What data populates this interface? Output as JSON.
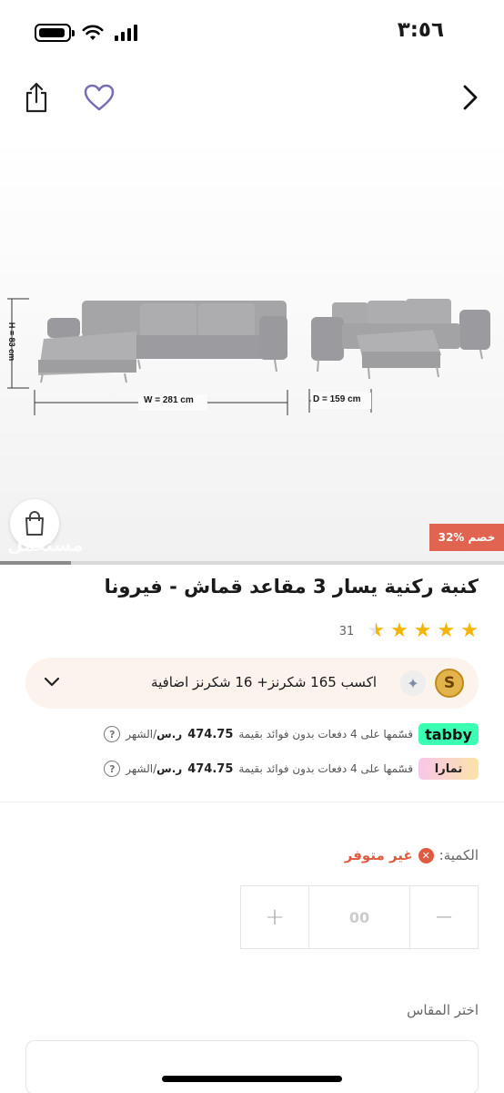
{
  "status": {
    "time": "٣:٥٦"
  },
  "topbar": {
    "back_icon": "chevron-right-icon",
    "favorite_icon": "heart-icon",
    "share_icon": "share-icon"
  },
  "product_image": {
    "dimension_height": "H = 83 cm",
    "dimension_width": "W = 281 cm",
    "dimension_depth": "D = 159 cm",
    "discount": "32% خصم",
    "watermark": "مستعمل",
    "gallery_progress": 0.14
  },
  "product": {
    "title": "كنبة ركنية يسار 3 مقاعد قماش - فيرونا",
    "rating": 4.5,
    "reviews_count": "31"
  },
  "points": {
    "coin_letter": "S",
    "text": "اكسب 165 شكرنز+  16 شكرنز اضافية"
  },
  "payments": {
    "tabby": {
      "logo": "tabby",
      "text": "قسّمها على 4 دفعات بدون فوائد بقيمة",
      "amount": "474.75",
      "currency": "ر.س",
      "period": "/الشهر"
    },
    "tamara": {
      "logo": "تمارا",
      "text": "قسّمها على 4 دفعات بدون فوائد بقيمة",
      "amount": "474.75",
      "currency": "ر.س",
      "period": "/الشهر"
    }
  },
  "quantity": {
    "label": "الكمية:",
    "status": "غير متوفر",
    "value": "00",
    "plus": "+",
    "minus": "−"
  },
  "size": {
    "label": "اختر المقاس"
  },
  "colors": {
    "discount": "#e06450",
    "unavailable": "#e05a40",
    "star": "#f5b400",
    "tabby": "#3bffb1",
    "heart": "#7a6bb5"
  }
}
